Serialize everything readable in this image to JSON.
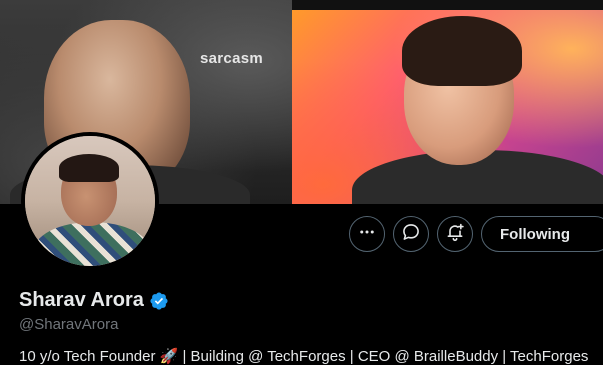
{
  "banner": {
    "left_caption": "sarcasm"
  },
  "profile": {
    "display_name": "Sharav Arora",
    "handle": "@SharavArora",
    "bio": "10 y/o Tech Founder 🚀 | Building @ TechForges | CEO @ BrailleBuddy | TechForges",
    "verified": true
  },
  "actions": {
    "more_icon": "more-horizontal-icon",
    "message_icon": "message-icon",
    "notify_icon": "bell-plus-icon",
    "follow_label": "Following"
  },
  "colors": {
    "background": "#000000",
    "text_primary": "#e7e9ea",
    "text_secondary": "#71767b",
    "border": "#536471",
    "verified_blue": "#1d9bf0"
  }
}
